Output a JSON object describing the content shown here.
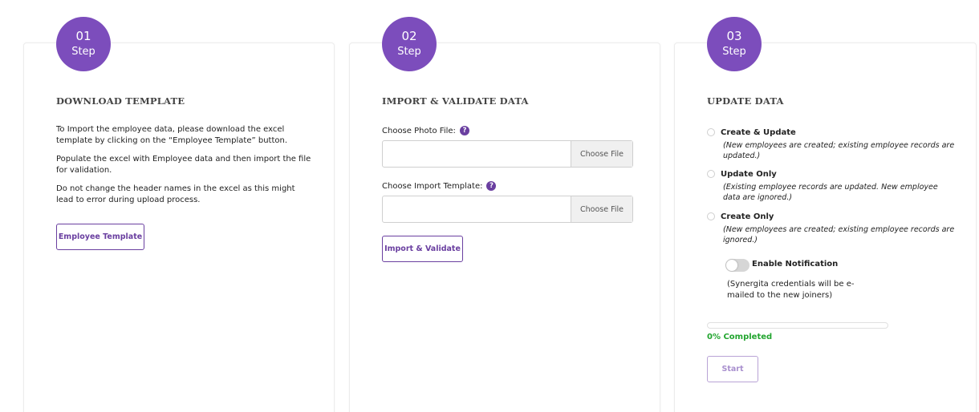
{
  "steps": [
    {
      "number": "01",
      "step_label": "Step",
      "title": "DOWNLOAD TEMPLATE",
      "paragraphs": [
        "To Import the employee data, please download the excel template by clicking on the “Employee Template” button.",
        "Populate the excel with Employee data and then import the file for validation.",
        "Do not change the header names in the excel as this might lead to error during upload process."
      ],
      "button_label": "Employee Template"
    },
    {
      "number": "02",
      "step_label": "Step",
      "title": "IMPORT & VALIDATE DATA",
      "photo_label": "Choose Photo File:",
      "template_label": "Choose Import Template:",
      "choose_file_label": "Choose File",
      "help_glyph": "?",
      "button_label": "Import & Validate"
    },
    {
      "number": "03",
      "step_label": "Step",
      "title": "UPDATE DATA",
      "options": [
        {
          "label": "Create & Update",
          "desc": "(New employees are created; existing employee records are updated.)"
        },
        {
          "label": "Update Only",
          "desc": "(Existing employee records are updated. New employee data are ignored.)"
        },
        {
          "label": "Create Only",
          "desc": "(New employees are created; existing employee records are ignored.)"
        }
      ],
      "notification_label": "Enable Notification",
      "notification_note": "(Synergita credentials will be e-mailed to the new joiners)",
      "notification_enabled": false,
      "progress_percent": 0,
      "progress_text": "0% Completed",
      "button_label": "Start"
    }
  ],
  "colors": {
    "accent": "#7c4dbc",
    "button_border": "#6a3fa0",
    "progress_green": "#22a52f"
  },
  "icons": {
    "help": "question-circle-icon"
  }
}
